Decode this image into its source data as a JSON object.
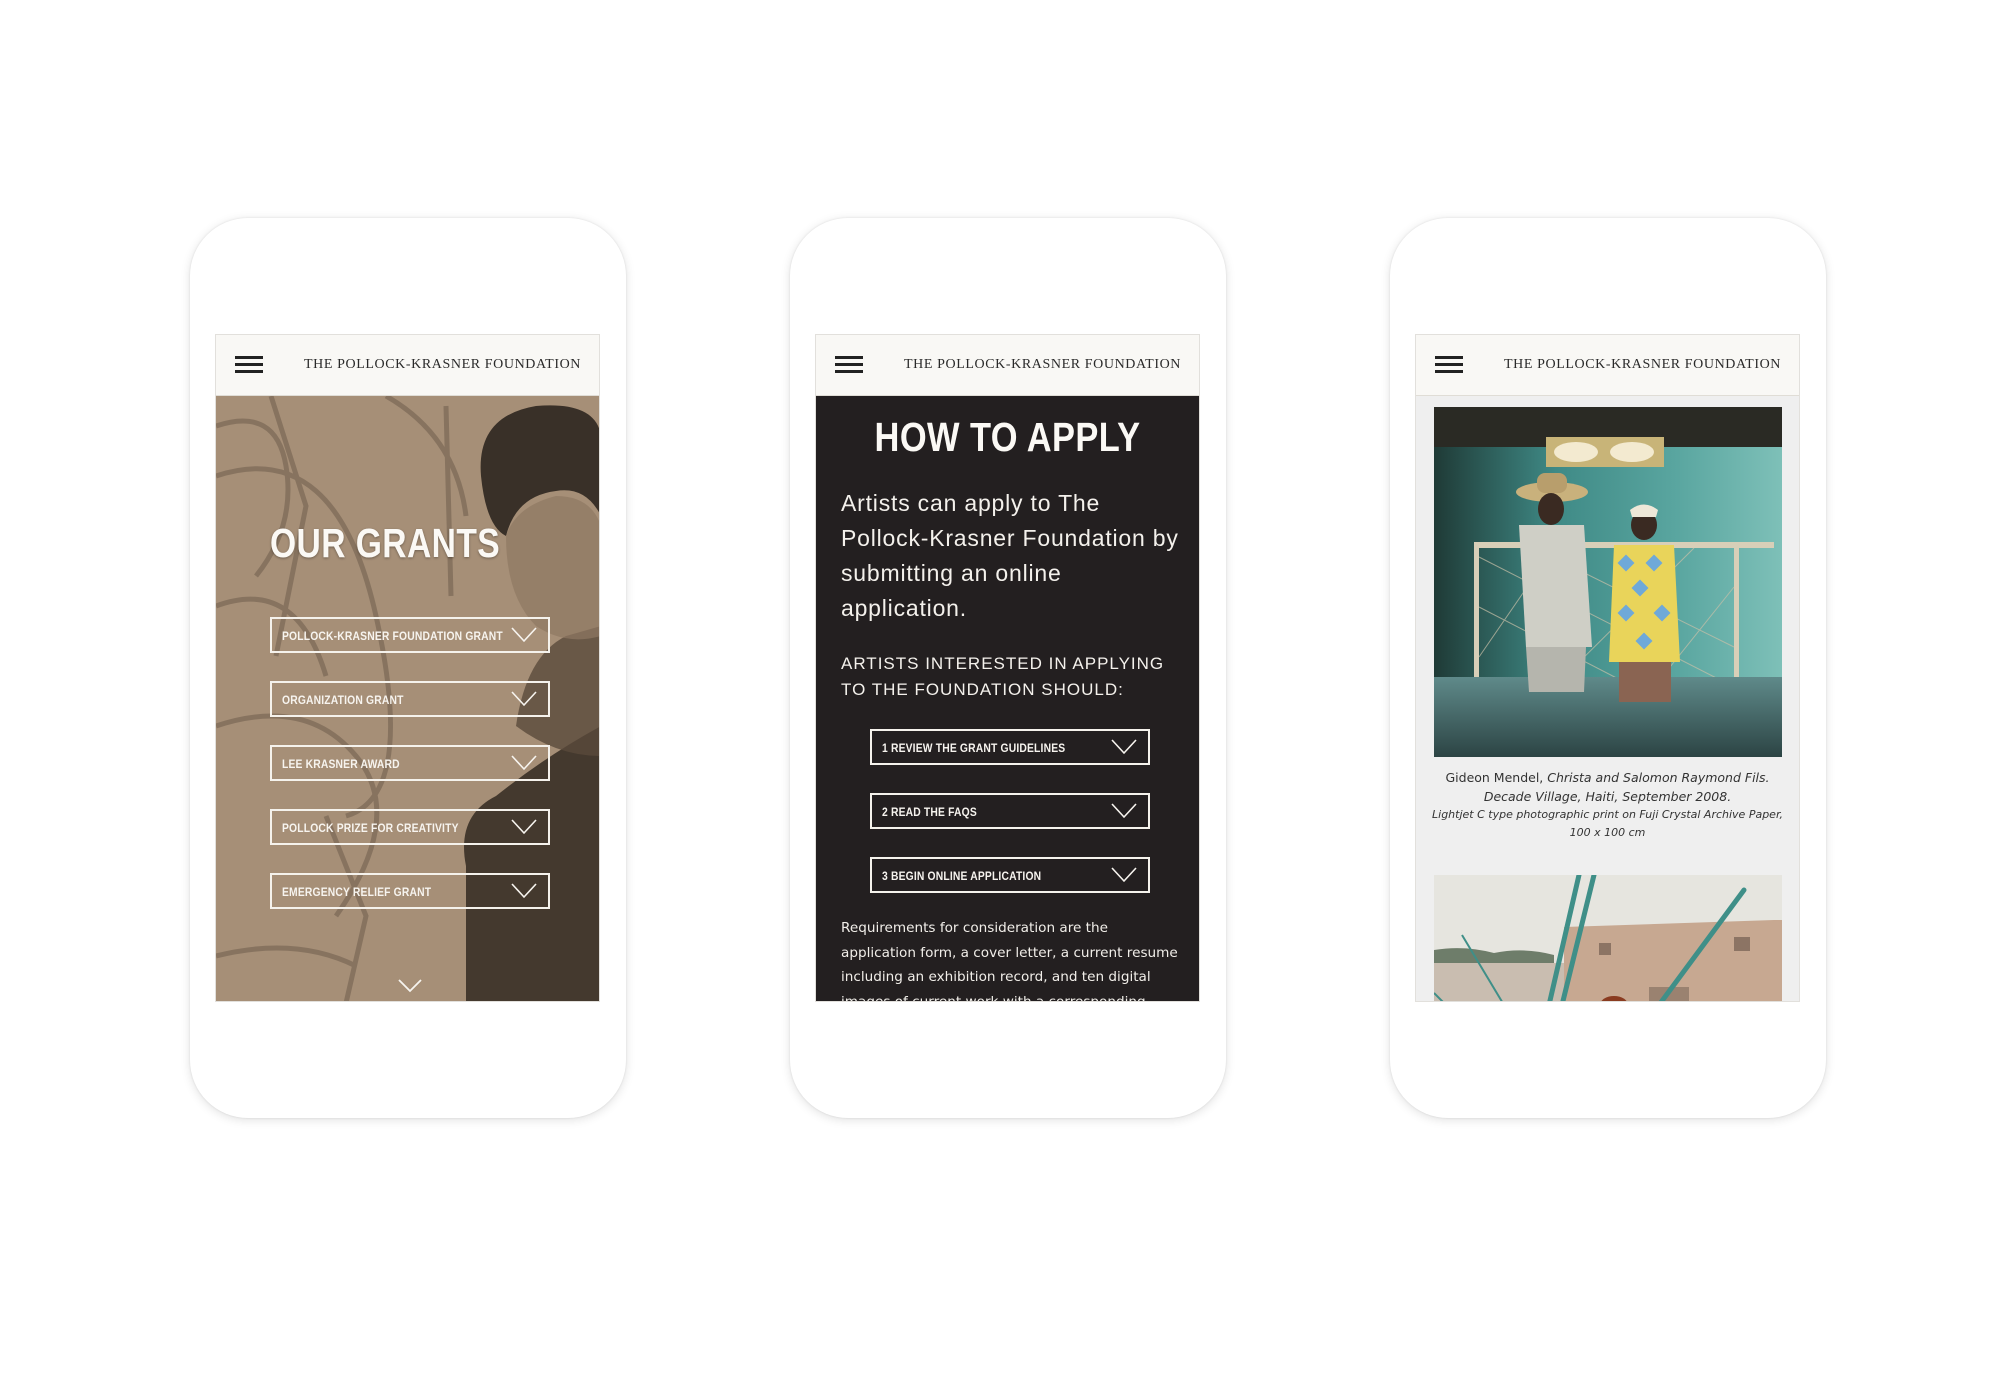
{
  "site": {
    "title": "THE POLLOCK-KRASNER FOUNDATION",
    "menu_icon": "hamburger-menu-icon"
  },
  "colors": {
    "header_bg": "#f9f8f5",
    "hero_sepia": "#a68f77",
    "dark_bg": "#231f20",
    "gallery_bg": "#efefef",
    "text_light": "#fbf9f5"
  },
  "phones": [
    {
      "page": "our-grants",
      "heading": "OUR GRANTS",
      "accordion": [
        {
          "label": "POLLOCK-KRASNER FOUNDATION GRANT"
        },
        {
          "label": "ORGANIZATION GRANT"
        },
        {
          "label": "LEE KRASNER AWARD"
        },
        {
          "label": "POLLOCK PRIZE FOR CREATIVITY"
        },
        {
          "label": "EMERGENCY RELIEF GRANT"
        }
      ],
      "scroll_icon": "chevron-down-icon"
    },
    {
      "page": "how-to-apply",
      "heading": "HOW TO APPLY",
      "lead": "Artists can apply to The Pollock-Krasner Foundation by submitting an online application.",
      "subheading": "ARTISTS INTERESTED IN APPLYING TO THE FOUNDATION SHOULD:",
      "steps": [
        {
          "label": "1 REVIEW THE GRANT GUIDELINES"
        },
        {
          "label": "2 READ THE FAQS"
        },
        {
          "label": "3 BEGIN ONLINE APPLICATION"
        }
      ],
      "body": "Requirements for consideration are the application form, a cover letter, a current resume including an exhibition record, and ten digital images of current work with a corresponding"
    },
    {
      "page": "gallery",
      "caption": {
        "artist": "Gideon Mendel, ",
        "title": "Christa and Salomon Raymond Fils. Decade Village, Haiti, September 2008.",
        "medium": "Lightjet C type photographic print on Fuji Crystal Archive Paper, 100 x 100 cm"
      }
    }
  ]
}
